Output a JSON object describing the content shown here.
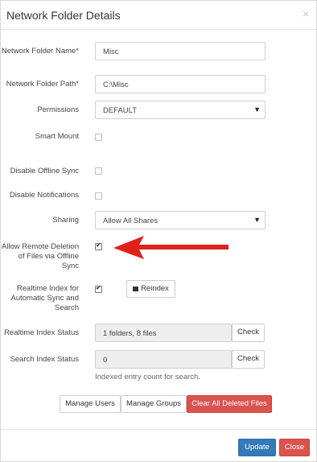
{
  "dialog": {
    "title": "Network Folder Details",
    "close": "×"
  },
  "fields": {
    "folder_name": {
      "label": "Network Folder Name*",
      "value": "Misc"
    },
    "folder_path": {
      "label": "Network Folder Path*",
      "value": "C:\\Misc"
    },
    "permissions": {
      "label": "Permissions",
      "value": "DEFAULT"
    },
    "smart_mount": {
      "label": "Smart Mount",
      "checked": false
    },
    "disable_offline_sync": {
      "label": "Disable Offline Sync",
      "checked": false
    },
    "disable_notifications": {
      "label": "Disable Notifications",
      "checked": false
    },
    "sharing": {
      "label": "Sharing",
      "value": "Allow All Shares"
    },
    "allow_remote_deletion": {
      "label": "Allow Remote Deletion of Files via Offline Sync",
      "checked": true
    },
    "realtime_index": {
      "label": "Realtime Index for Automatic Sync and Search",
      "checked": true,
      "reindex_label": "Reindex"
    },
    "realtime_index_status": {
      "label": "Realtime Index Status",
      "value": "1 folders, 8 files",
      "button": "Check"
    },
    "search_index_status": {
      "label": "Search Index Status",
      "value": "0",
      "button": "Check",
      "helper": "Indexed entry count for search."
    }
  },
  "actions": {
    "manage_users": "Manage Users",
    "manage_groups": "Manage Groups",
    "clear_deleted": "Clear All Deleted Files"
  },
  "footer": {
    "update": "Update",
    "close": "Close"
  },
  "colors": {
    "primary": "#337ab7",
    "danger": "#d9534f",
    "annotation_arrow": "#e0201b"
  }
}
